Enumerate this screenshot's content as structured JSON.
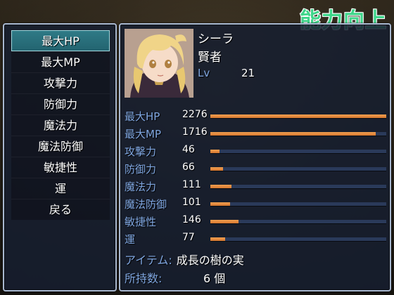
{
  "title_badge": "能力向上",
  "commands": [
    {
      "label": "最大HP",
      "selected": true
    },
    {
      "label": "最大MP",
      "selected": false
    },
    {
      "label": "攻撃力",
      "selected": false
    },
    {
      "label": "防御力",
      "selected": false
    },
    {
      "label": "魔法力",
      "selected": false
    },
    {
      "label": "魔法防御",
      "selected": false
    },
    {
      "label": "敏捷性",
      "selected": false
    },
    {
      "label": "運",
      "selected": false
    },
    {
      "label": "戻る",
      "selected": false
    }
  ],
  "character": {
    "name": "シーラ",
    "class": "賢者",
    "lv_label": "Lv",
    "lv_value": "21"
  },
  "stats": [
    {
      "label": "最大HP",
      "value": "2276",
      "fill": 1.0
    },
    {
      "label": "最大MP",
      "value": "1716",
      "fill": 0.94
    },
    {
      "label": "攻撃力",
      "value": "46",
      "fill": 0.05
    },
    {
      "label": "防御力",
      "value": "66",
      "fill": 0.07
    },
    {
      "label": "魔法力",
      "value": "111",
      "fill": 0.12
    },
    {
      "label": "魔法防御",
      "value": "101",
      "fill": 0.11
    },
    {
      "label": "敏捷性",
      "value": "146",
      "fill": 0.16
    },
    {
      "label": "運",
      "value": "77",
      "fill": 0.085
    }
  ],
  "item": {
    "label": "アイテム:",
    "name": "成長の樹の実"
  },
  "owned": {
    "label": "所持数:",
    "count": "6 個"
  },
  "colors": {
    "system_blue": "#7fa6e0",
    "bar_orange": "#e08840",
    "badge_green": "#3fd68a",
    "selection_teal": "#2f7a86"
  }
}
